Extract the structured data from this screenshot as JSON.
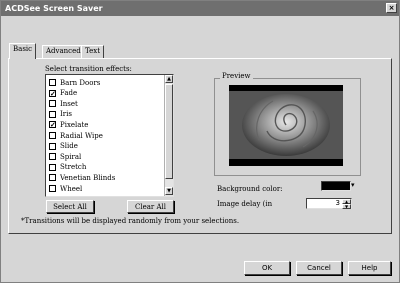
{
  "window": {
    "title": "ACDSee Screen Saver",
    "close_glyph": "×"
  },
  "tabs": [
    {
      "label": "Basic"
    },
    {
      "label": "Advanced"
    },
    {
      "label": "Text"
    }
  ],
  "basic": {
    "effects_label": "Select transition effects:",
    "effects": [
      {
        "label": "Barn Doors",
        "checked": false
      },
      {
        "label": "Fade",
        "checked": true
      },
      {
        "label": "Inset",
        "checked": false
      },
      {
        "label": "Iris",
        "checked": false
      },
      {
        "label": "Pixelate",
        "checked": true
      },
      {
        "label": "Radial Wipe",
        "checked": false
      },
      {
        "label": "Slide",
        "checked": false
      },
      {
        "label": "Spiral",
        "checked": false
      },
      {
        "label": "Stretch",
        "checked": false
      },
      {
        "label": "Venetian Blinds",
        "checked": false
      },
      {
        "label": "Wheel",
        "checked": false
      }
    ],
    "select_all_label": "Select All",
    "clear_all_label": "Clear All",
    "note": "*Transitions will be displayed randomly from your selections.",
    "preview_label": "Preview",
    "background_color_label": "Background color:",
    "background_color": "#000000",
    "image_delay_label": "Image delay (in",
    "image_delay_value": "3"
  },
  "footer": {
    "ok_label": "OK",
    "cancel_label": "Cancel",
    "help_label": "Help"
  }
}
